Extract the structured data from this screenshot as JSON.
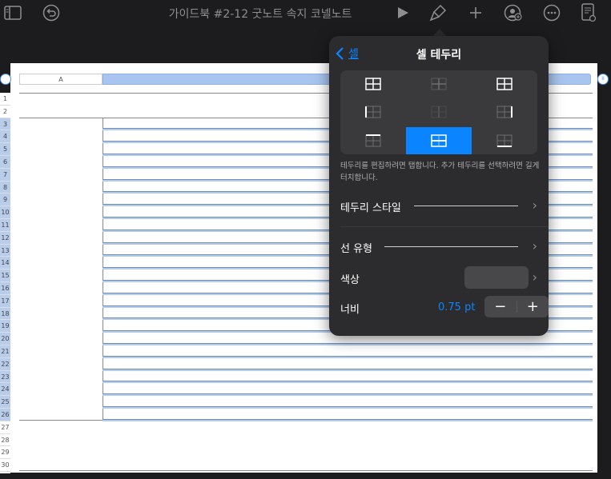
{
  "toolbar": {
    "document_title": "가이드북 #2-12 굿노트 속지 코넬노트",
    "icons": [
      "sidebar-icon",
      "undo-icon",
      "play-icon",
      "paintbrush-icon",
      "plus-icon",
      "collaborate-icon",
      "more-icon",
      "document-settings-icon"
    ]
  },
  "sheet": {
    "column_a_label": "A",
    "rows": [
      "1",
      "2",
      "3",
      "4",
      "5",
      "6",
      "7",
      "8",
      "9",
      "10",
      "11",
      "12",
      "13",
      "14",
      "15",
      "16",
      "17",
      "18",
      "19",
      "20",
      "21",
      "22",
      "23",
      "24",
      "25",
      "26",
      "27",
      "28",
      "29",
      "30"
    ],
    "selected_rows": [
      "3",
      "4",
      "5",
      "6",
      "7",
      "8",
      "9",
      "10",
      "11",
      "12",
      "13",
      "14",
      "15",
      "16",
      "17",
      "18",
      "19",
      "20",
      "21",
      "22",
      "23",
      "24",
      "25",
      "26"
    ],
    "handle_left": "",
    "handle_right": "II"
  },
  "popover": {
    "back_label": "셀",
    "title": "셀 테두리",
    "hint": "테두리를 편집하려면 탭합니다. 추가 테두리를 선택하려면 길게 터치합니다.",
    "border_style_label": "테두리 스타일",
    "line_type_label": "선 유형",
    "color_label": "색상",
    "color_value": "#48484a",
    "width_label": "너비",
    "width_value": "0.75 pt",
    "minus_label": "−",
    "plus_label": "+",
    "selected_preset_index": 7
  },
  "colors": {
    "accent": "#0a84ff",
    "selection_blue": "#a9c5ef"
  }
}
